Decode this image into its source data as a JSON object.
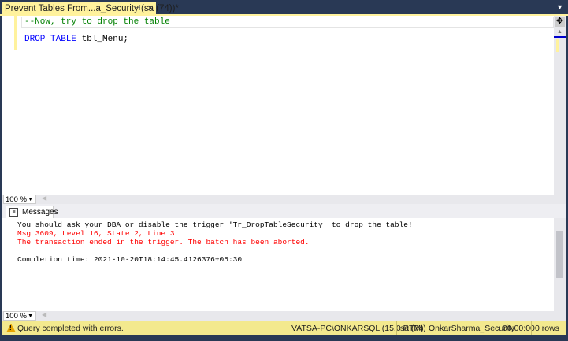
{
  "tab": {
    "title": "Prevent Tables From...a_Security (sa (74))*",
    "pin_icon": "⊣",
    "close_icon": "✕"
  },
  "editor": {
    "lines": [
      "--Now, try to drop the table",
      "DROP TABLE",
      "tbl_Menu;"
    ]
  },
  "editor_zoom": "100 %",
  "results": {
    "tab_label": "Messages",
    "messages": [
      "You should ask your DBA or disable the trigger 'Tr_DropTableSecurity' to drop the table!",
      "Msg 3609, Level 16, State 2, Line 3",
      "The transaction ended in the trigger. The batch has been aborted.",
      "Completion time: 2021-10-20T18:14:45.4126376+05:30"
    ]
  },
  "results_zoom": "100 %",
  "status": {
    "message": "Query completed with errors.",
    "server": "VATSA-PC\\ONKARSQL (15.0 RTM)",
    "user": "sa (74)",
    "database": "OnkarSharma_Security",
    "elapsed": "00:00:00",
    "rows": "0 rows"
  },
  "colors": {
    "accent": "#fff29d",
    "status_bg": "#f3e98e",
    "frame": "#293955",
    "error": "#ff0000"
  }
}
